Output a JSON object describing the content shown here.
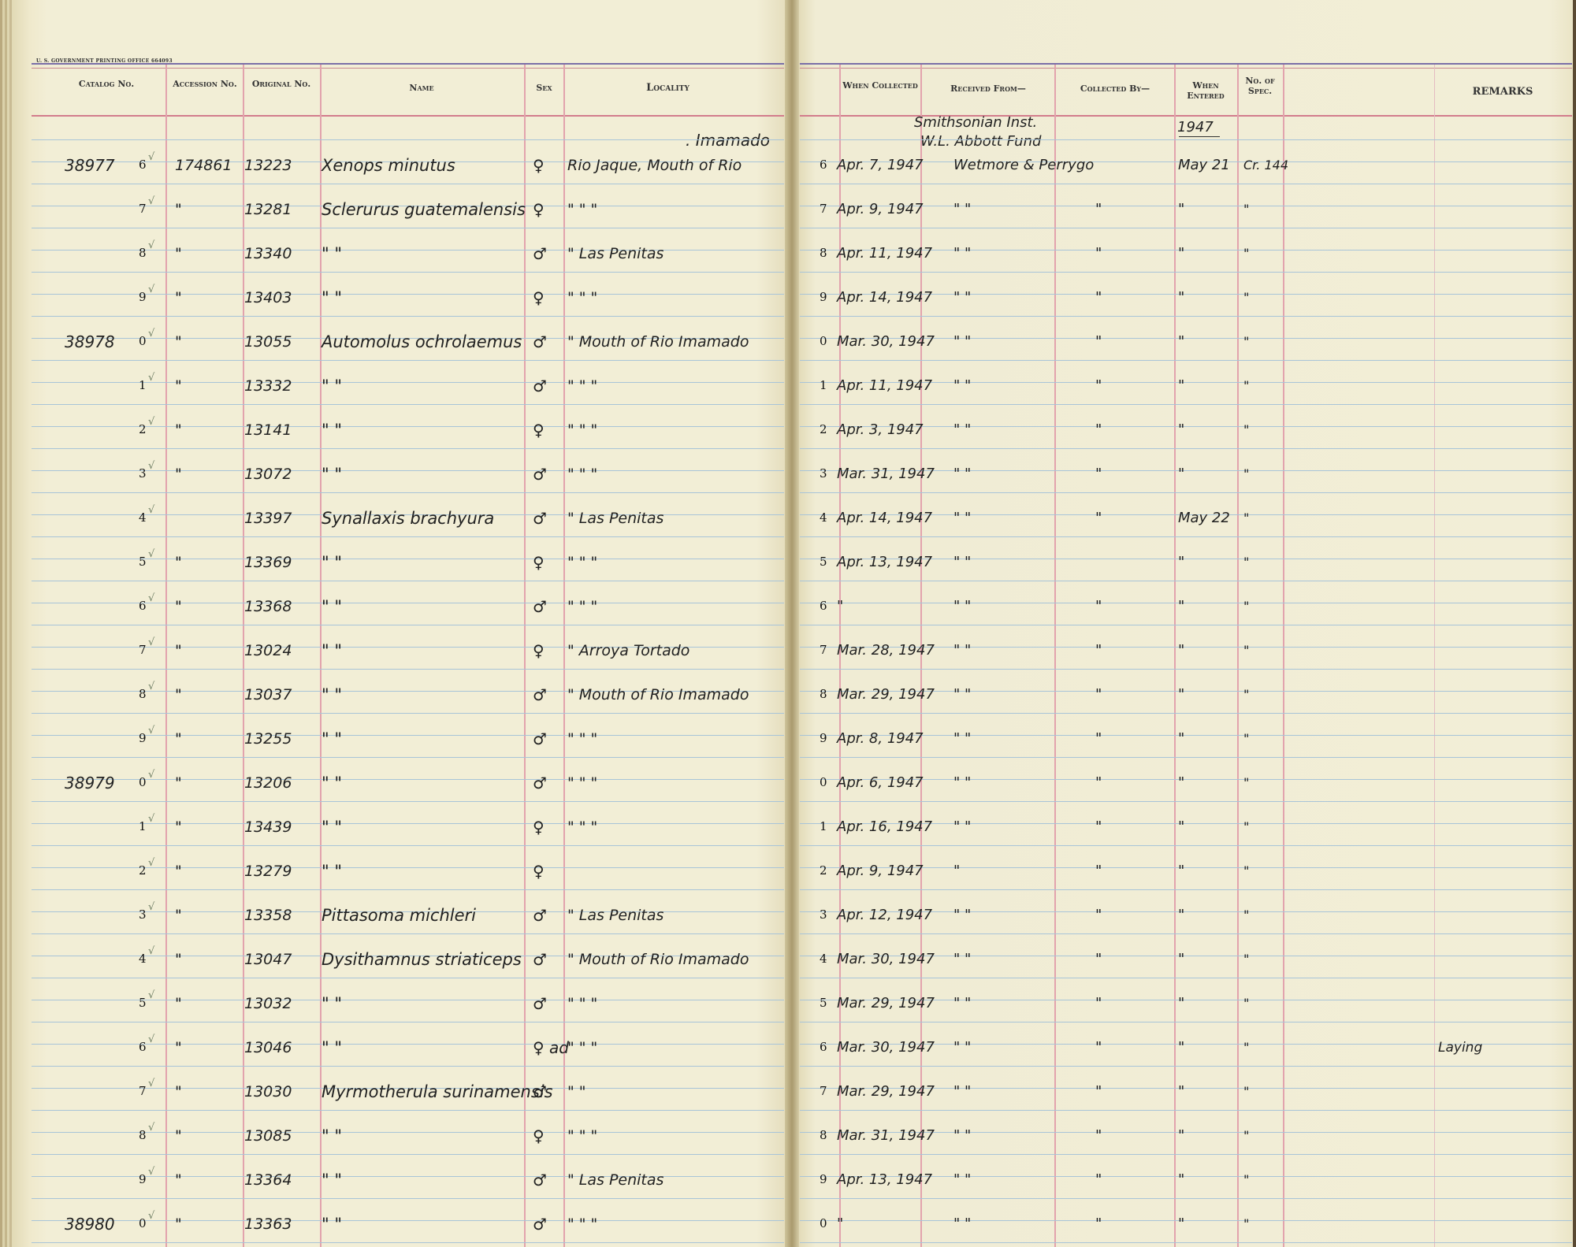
{
  "printer_line": "U. S. GOVERNMENT PRINTING OFFICE   664093",
  "headers": {
    "catalog": "Catalog No.",
    "accession": "Accession No.",
    "original": "Original No.",
    "name": "Name",
    "sex": "Sex",
    "locality": "Locality",
    "when_collected": "When Collected",
    "received_from": "Received From—",
    "collected_by": "Collected By—",
    "when_entered": "When Entered",
    "no_of_spec": "No. of Spec.",
    "remarks": "REMARKS"
  },
  "header_notes": {
    "locality_top": ". Imamado",
    "received_top_1": "Smithsonian Inst.",
    "received_top_2": "W.L. Abbott Fund",
    "entered_top": "1947"
  },
  "rows": [
    {
      "catalog": "38977",
      "digit": "6",
      "accession": "174861",
      "original": "13223",
      "name": "Xenops minutus",
      "sex": "♀",
      "locality": "Rio Jaque, Mouth of Rio",
      "date_digit": "6",
      "date": "Apr. 7, 1947",
      "received": "Wetmore & Perrygo",
      "collected": "",
      "entered": "May 21",
      "spec": "Cr. 144",
      "remarks": ""
    },
    {
      "catalog": "",
      "digit": "7",
      "accession": "\"",
      "original": "13281",
      "name": "Sclerurus guatemalensis",
      "sex": "♀",
      "locality": "\"   \"   \"",
      "date_digit": "7",
      "date": "Apr. 9, 1947",
      "received": "\"   \"",
      "collected": "\"",
      "entered": "\"",
      "spec": "\"",
      "remarks": ""
    },
    {
      "catalog": "",
      "digit": "8",
      "accession": "\"",
      "original": "13340",
      "name": "\"      \"",
      "sex": "♂",
      "locality": "\" Las Penitas",
      "date_digit": "8",
      "date": "Apr. 11, 1947",
      "received": "\"   \"",
      "collected": "\"",
      "entered": "\"",
      "spec": "\"",
      "remarks": ""
    },
    {
      "catalog": "",
      "digit": "9",
      "accession": "\"",
      "original": "13403",
      "name": "\"      \"",
      "sex": "♀",
      "locality": "\"   \"   \"",
      "date_digit": "9",
      "date": "Apr. 14, 1947",
      "received": "\"   \"",
      "collected": "\"",
      "entered": "\"",
      "spec": "\"",
      "remarks": ""
    },
    {
      "catalog": "38978",
      "digit": "0",
      "accession": "\"",
      "original": "13055",
      "name": "Automolus ochrolaemus",
      "sex": "♂",
      "locality": "\" Mouth of Rio Imamado",
      "date_digit": "0",
      "date": "Mar. 30, 1947",
      "received": "\"   \"",
      "collected": "\"",
      "entered": "\"",
      "spec": "\"",
      "remarks": ""
    },
    {
      "catalog": "",
      "digit": "1",
      "accession": "\"",
      "original": "13332",
      "name": "\"      \"",
      "sex": "♂",
      "locality": "\"   \"   \"",
      "date_digit": "1",
      "date": "Apr. 11, 1947",
      "received": "\"   \"",
      "collected": "\"",
      "entered": "\"",
      "spec": "\"",
      "remarks": ""
    },
    {
      "catalog": "",
      "digit": "2",
      "accession": "\"",
      "original": "13141",
      "name": "\"      \"",
      "sex": "♀",
      "locality": "\"   \"   \"",
      "date_digit": "2",
      "date": "Apr. 3, 1947",
      "received": "\"   \"",
      "collected": "\"",
      "entered": "\"",
      "spec": "\"",
      "remarks": ""
    },
    {
      "catalog": "",
      "digit": "3",
      "accession": "\"",
      "original": "13072",
      "name": "\"      \"",
      "sex": "♂",
      "locality": "\"   \"   \"",
      "date_digit": "3",
      "date": "Mar. 31, 1947",
      "received": "\"   \"",
      "collected": "\"",
      "entered": "\"",
      "spec": "\"",
      "remarks": ""
    },
    {
      "catalog": "",
      "digit": "4",
      "accession": "",
      "original": "13397",
      "name": "Synallaxis brachyura",
      "sex": "♂",
      "locality": "\" Las Penitas",
      "date_digit": "4",
      "date": "Apr. 14, 1947",
      "received": "\"   \"",
      "collected": "\"",
      "entered": "May 22",
      "spec": "\"",
      "remarks": ""
    },
    {
      "catalog": "",
      "digit": "5",
      "accession": "\"",
      "original": "13369",
      "name": "\"      \"",
      "sex": "♀",
      "locality": "\"   \"   \"",
      "date_digit": "5",
      "date": "Apr. 13, 1947",
      "received": "\"   \"",
      "collected": "",
      "entered": "\"",
      "spec": "\"",
      "remarks": ""
    },
    {
      "catalog": "",
      "digit": "6",
      "accession": "\"",
      "original": "13368",
      "name": "\"      \"",
      "sex": "♂",
      "locality": "\"   \"   \"",
      "date_digit": "6",
      "date": "\"",
      "received": "\"   \"",
      "collected": "\"",
      "entered": "\"",
      "spec": "\"",
      "remarks": ""
    },
    {
      "catalog": "",
      "digit": "7",
      "accession": "\"",
      "original": "13024",
      "name": "\"      \"",
      "sex": "♀",
      "locality": "\" Arroya Tortado",
      "date_digit": "7",
      "date": "Mar. 28, 1947",
      "received": "\"   \"",
      "collected": "\"",
      "entered": "\"",
      "spec": "\"",
      "remarks": ""
    },
    {
      "catalog": "",
      "digit": "8",
      "accession": "\"",
      "original": "13037",
      "name": "\"      \"",
      "sex": "♂",
      "locality": "\" Mouth of Rio Imamado",
      "date_digit": "8",
      "date": "Mar. 29, 1947",
      "received": "\"   \"",
      "collected": "\"",
      "entered": "\"",
      "spec": "\"",
      "remarks": ""
    },
    {
      "catalog": "",
      "digit": "9",
      "accession": "\"",
      "original": "13255",
      "name": "\"      \"",
      "sex": "♂",
      "locality": "\"   \"   \"",
      "date_digit": "9",
      "date": "Apr. 8, 1947",
      "received": "\"   \"",
      "collected": "\"",
      "entered": "\"",
      "spec": "\"",
      "remarks": ""
    },
    {
      "catalog": "38979",
      "digit": "0",
      "accession": "\"",
      "original": "13206",
      "name": "\"      \"",
      "sex": "♂",
      "locality": "\"   \"   \"",
      "date_digit": "0",
      "date": "Apr. 6, 1947",
      "received": "\"   \"",
      "collected": "\"",
      "entered": "\"",
      "spec": "\"",
      "remarks": ""
    },
    {
      "catalog": "",
      "digit": "1",
      "accession": "\"",
      "original": "13439",
      "name": "\"      \"",
      "sex": "♀",
      "locality": "\"   \"   \"",
      "date_digit": "1",
      "date": "Apr. 16, 1947",
      "received": "\"   \"",
      "collected": "\"",
      "entered": "\"",
      "spec": "\"",
      "remarks": ""
    },
    {
      "catalog": "",
      "digit": "2",
      "accession": "\"",
      "original": "13279",
      "name": "\"      \"",
      "sex": "♀",
      "locality": "",
      "date_digit": "2",
      "date": "Apr. 9, 1947",
      "received": "\"",
      "collected": "\"",
      "entered": "\"",
      "spec": "\"",
      "remarks": ""
    },
    {
      "catalog": "",
      "digit": "3",
      "accession": "\"",
      "original": "13358",
      "name": "Pittasoma michleri",
      "sex": "♂",
      "locality": "\" Las Penitas",
      "date_digit": "3",
      "date": "Apr. 12, 1947",
      "received": "\"   \"",
      "collected": "\"",
      "entered": "\"",
      "spec": "\"",
      "remarks": ""
    },
    {
      "catalog": "",
      "digit": "4",
      "accession": "\"",
      "original": "13047",
      "name": "Dysithamnus striaticeps",
      "sex": "♂",
      "locality": "\" Mouth of Rio Imamado",
      "date_digit": "4",
      "date": "Mar. 30, 1947",
      "received": "\"   \"",
      "collected": "\"",
      "entered": "\"",
      "spec": "\"",
      "remarks": ""
    },
    {
      "catalog": "",
      "digit": "5",
      "accession": "\"",
      "original": "13032",
      "name": "\"      \"",
      "sex": "♂",
      "locality": "\"   \"   \"",
      "date_digit": "5",
      "date": "Mar. 29, 1947",
      "received": "\"   \"",
      "collected": "\"",
      "entered": "\"",
      "spec": "\"",
      "remarks": ""
    },
    {
      "catalog": "",
      "digit": "6",
      "accession": "\"",
      "original": "13046",
      "name": "\"      \"",
      "sex": "♀ ad",
      "locality": "\"   \"   \"",
      "date_digit": "6",
      "date": "Mar. 30, 1947",
      "received": "\"   \"",
      "collected": "\"",
      "entered": "\"",
      "spec": "\"",
      "remarks": "Laying"
    },
    {
      "catalog": "",
      "digit": "7",
      "accession": "\"",
      "original": "13030",
      "name": "Myrmotherula surinamensis",
      "sex": "♂",
      "locality": "\"   \"",
      "date_digit": "7",
      "date": "Mar. 29, 1947",
      "received": "\"   \"",
      "collected": "\"",
      "entered": "\"",
      "spec": "\"",
      "remarks": ""
    },
    {
      "catalog": "",
      "digit": "8",
      "accession": "\"",
      "original": "13085",
      "name": "\"      \"",
      "sex": "♀",
      "locality": "\"   \"   \"",
      "date_digit": "8",
      "date": "Mar. 31, 1947",
      "received": "\"   \"",
      "collected": "\"",
      "entered": "\"",
      "spec": "\"",
      "remarks": ""
    },
    {
      "catalog": "",
      "digit": "9",
      "accession": "\"",
      "original": "13364",
      "name": "\"      \"",
      "sex": "♂",
      "locality": "\" Las Penitas",
      "date_digit": "9",
      "date": "Apr. 13, 1947",
      "received": "\"   \"",
      "collected": "\"",
      "entered": "\"",
      "spec": "\"",
      "remarks": ""
    },
    {
      "catalog": "38980",
      "digit": "0",
      "accession": "\"",
      "original": "13363",
      "name": "\"      \"",
      "sex": "♂",
      "locality": "\"   \"   \"",
      "date_digit": "0",
      "date": "\"",
      "received": "\"   \"",
      "collected": "\"",
      "entered": "\"",
      "spec": "\"",
      "remarks": ""
    }
  ]
}
